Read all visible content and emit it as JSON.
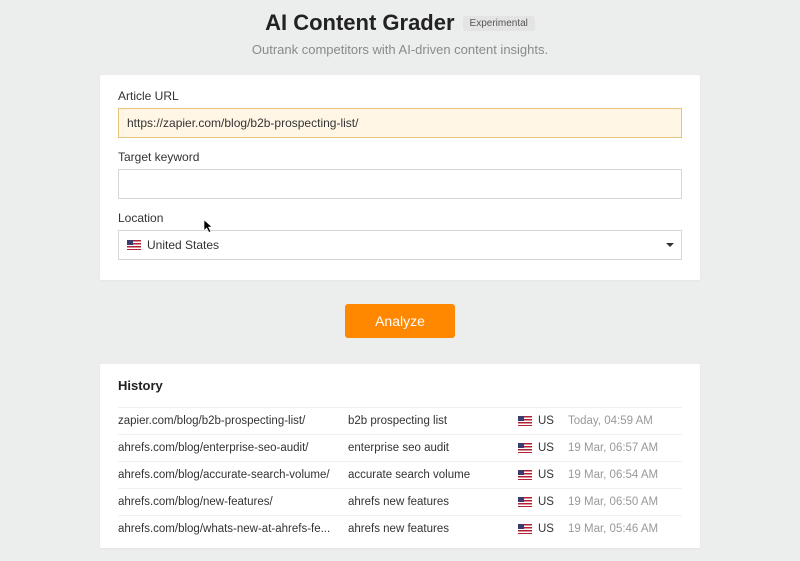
{
  "header": {
    "title": "AI Content Grader",
    "badge": "Experimental",
    "subtitle": "Outrank competitors with AI-driven content insights."
  },
  "form": {
    "url_label": "Article URL",
    "url_value": "https://zapier.com/blog/b2b-prospecting-list/",
    "keyword_label": "Target keyword",
    "keyword_value": "",
    "location_label": "Location",
    "location_value": "United States",
    "location_code": "US"
  },
  "actions": {
    "analyze": "Analyze"
  },
  "history": {
    "title": "History",
    "rows": [
      {
        "url": "zapier.com/blog/b2b-prospecting-list/",
        "keyword": "b2b prospecting list",
        "loc": "US",
        "time": "Today, 04:59 AM"
      },
      {
        "url": "ahrefs.com/blog/enterprise-seo-audit/",
        "keyword": "enterprise seo audit",
        "loc": "US",
        "time": "19 Mar, 06:57 AM"
      },
      {
        "url": "ahrefs.com/blog/accurate-search-volume/",
        "keyword": "accurate search volume",
        "loc": "US",
        "time": "19 Mar, 06:54 AM"
      },
      {
        "url": "ahrefs.com/blog/new-features/",
        "keyword": "ahrefs new features",
        "loc": "US",
        "time": "19 Mar, 06:50 AM"
      },
      {
        "url": "ahrefs.com/blog/whats-new-at-ahrefs-fe...",
        "keyword": "ahrefs new features",
        "loc": "US",
        "time": "19 Mar, 05:46 AM"
      }
    ]
  }
}
